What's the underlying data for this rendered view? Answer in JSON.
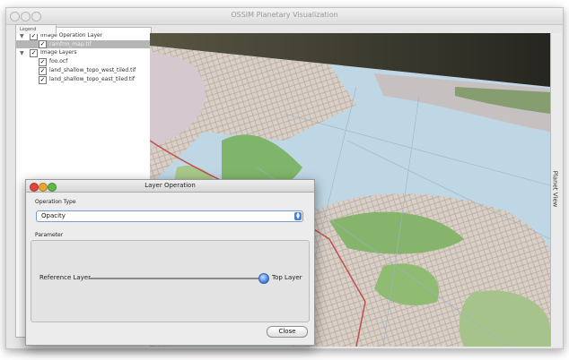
{
  "window": {
    "title": "OSSIM Planetary Visualization"
  },
  "legend": {
    "tab_label": "Legend",
    "items": [
      {
        "label": "Image Operation Layer",
        "checked": true,
        "level": 0,
        "expanded": true,
        "selected": false
      },
      {
        "label": "ramfrm_map.tif",
        "checked": true,
        "level": 1,
        "selected": true
      },
      {
        "label": "Image Layers",
        "checked": true,
        "level": 0,
        "expanded": true,
        "selected": false
      },
      {
        "label": "foo.ocf",
        "checked": true,
        "level": 1,
        "selected": false
      },
      {
        "label": "land_shallow_topo_west_tiled.tif",
        "checked": true,
        "level": 1,
        "selected": false
      },
      {
        "label": "land_shallow_topo_east_tiled.tif",
        "checked": true,
        "level": 1,
        "selected": false
      }
    ]
  },
  "map_view": {
    "side_tab_label": "Planet View"
  },
  "dialog": {
    "title": "Layer Operation",
    "operation_type_label": "Operation Type",
    "operation_type_value": "Opacity",
    "parameter_label": "Parameter",
    "slider_left_label": "Reference Layer",
    "slider_right_label": "Top Layer",
    "slider_value": 1.0,
    "close_label": "Close"
  },
  "colors": {
    "accent": "#4a7fd8",
    "close_light": "#e0443e",
    "minimize_light": "#e2a832",
    "zoom_light": "#5cb847"
  }
}
